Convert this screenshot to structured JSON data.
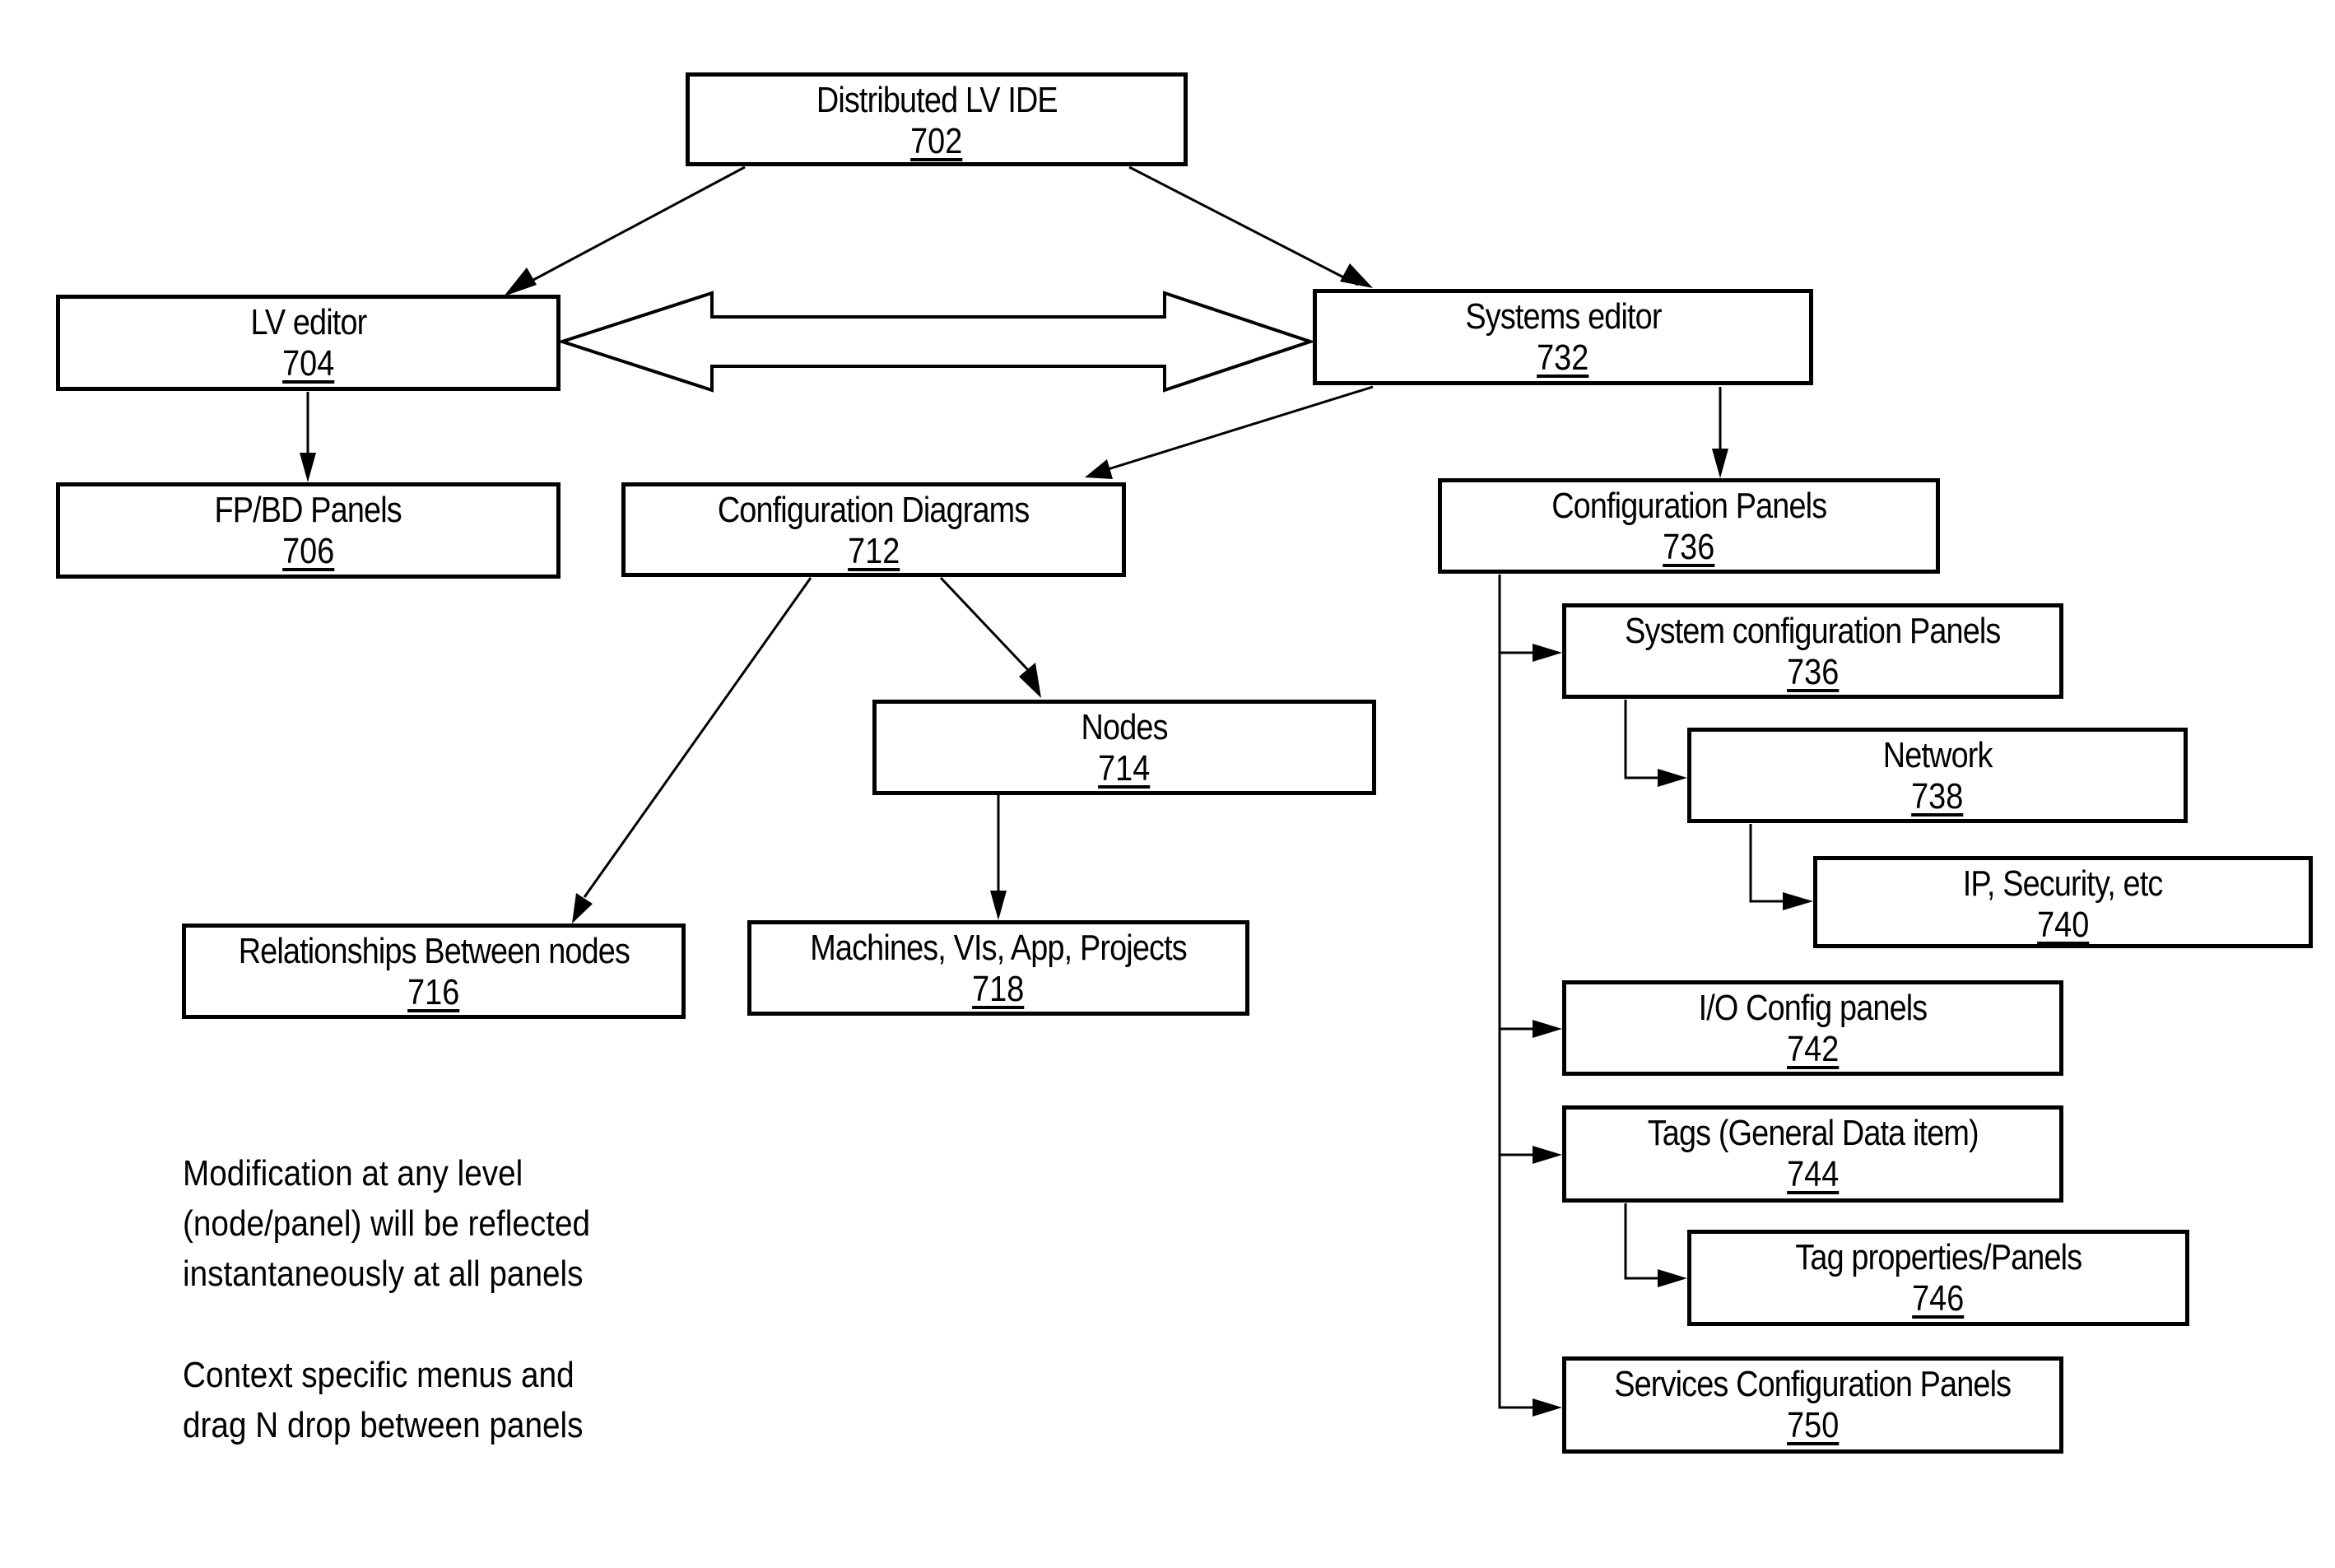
{
  "diagram": {
    "nodes": [
      {
        "id": "702",
        "label": "Distributed LV IDE",
        "ref": "702"
      },
      {
        "id": "704",
        "label": "LV editor",
        "ref": "704"
      },
      {
        "id": "732",
        "label": "Systems editor",
        "ref": "732"
      },
      {
        "id": "706",
        "label": "FP/BD Panels",
        "ref": "706"
      },
      {
        "id": "712",
        "label": "Configuration Diagrams",
        "ref": "712"
      },
      {
        "id": "736",
        "label": "Configuration Panels",
        "ref": "736"
      },
      {
        "id": "736b",
        "label": "System configuration Panels",
        "ref": "736"
      },
      {
        "id": "738",
        "label": "Network",
        "ref": "738"
      },
      {
        "id": "740",
        "label": "IP, Security, etc",
        "ref": "740"
      },
      {
        "id": "714",
        "label": "Nodes",
        "ref": "714"
      },
      {
        "id": "716",
        "label": "Relationships Between nodes",
        "ref": "716"
      },
      {
        "id": "718",
        "label": "Machines, VIs, App, Projects",
        "ref": "718"
      },
      {
        "id": "742",
        "label": "I/O Config panels",
        "ref": "742"
      },
      {
        "id": "744",
        "label": "Tags (General Data item)",
        "ref": "744"
      },
      {
        "id": "746",
        "label": "Tag properties/Panels",
        "ref": "746"
      },
      {
        "id": "750",
        "label": "Services Configuration Panels",
        "ref": "750"
      }
    ],
    "edges": [
      {
        "from": "702",
        "to": "704",
        "type": "arrow"
      },
      {
        "from": "702",
        "to": "732",
        "type": "arrow"
      },
      {
        "from": "704",
        "to": "732",
        "type": "bidirectional-block-arrow"
      },
      {
        "from": "704",
        "to": "706",
        "type": "arrow"
      },
      {
        "from": "732",
        "to": "712",
        "type": "arrow"
      },
      {
        "from": "732",
        "to": "736",
        "type": "arrow"
      },
      {
        "from": "712",
        "to": "714",
        "type": "arrow"
      },
      {
        "from": "712",
        "to": "716",
        "type": "arrow"
      },
      {
        "from": "714",
        "to": "718",
        "type": "arrow"
      },
      {
        "from": "736",
        "to": "736b",
        "type": "elbow-arrow"
      },
      {
        "from": "736b",
        "to": "738",
        "type": "elbow-arrow"
      },
      {
        "from": "738",
        "to": "740",
        "type": "elbow-arrow"
      },
      {
        "from": "736",
        "to": "742",
        "type": "elbow-arrow"
      },
      {
        "from": "736",
        "to": "744",
        "type": "elbow-arrow"
      },
      {
        "from": "744",
        "to": "746",
        "type": "elbow-arrow"
      },
      {
        "from": "736",
        "to": "750",
        "type": "elbow-arrow"
      }
    ],
    "notes": [
      [
        "Modification at any level",
        "(node/panel) will be reflected",
        "instantaneously at all panels"
      ],
      [
        "Context specific menus and",
        "drag N drop between panels"
      ]
    ]
  }
}
